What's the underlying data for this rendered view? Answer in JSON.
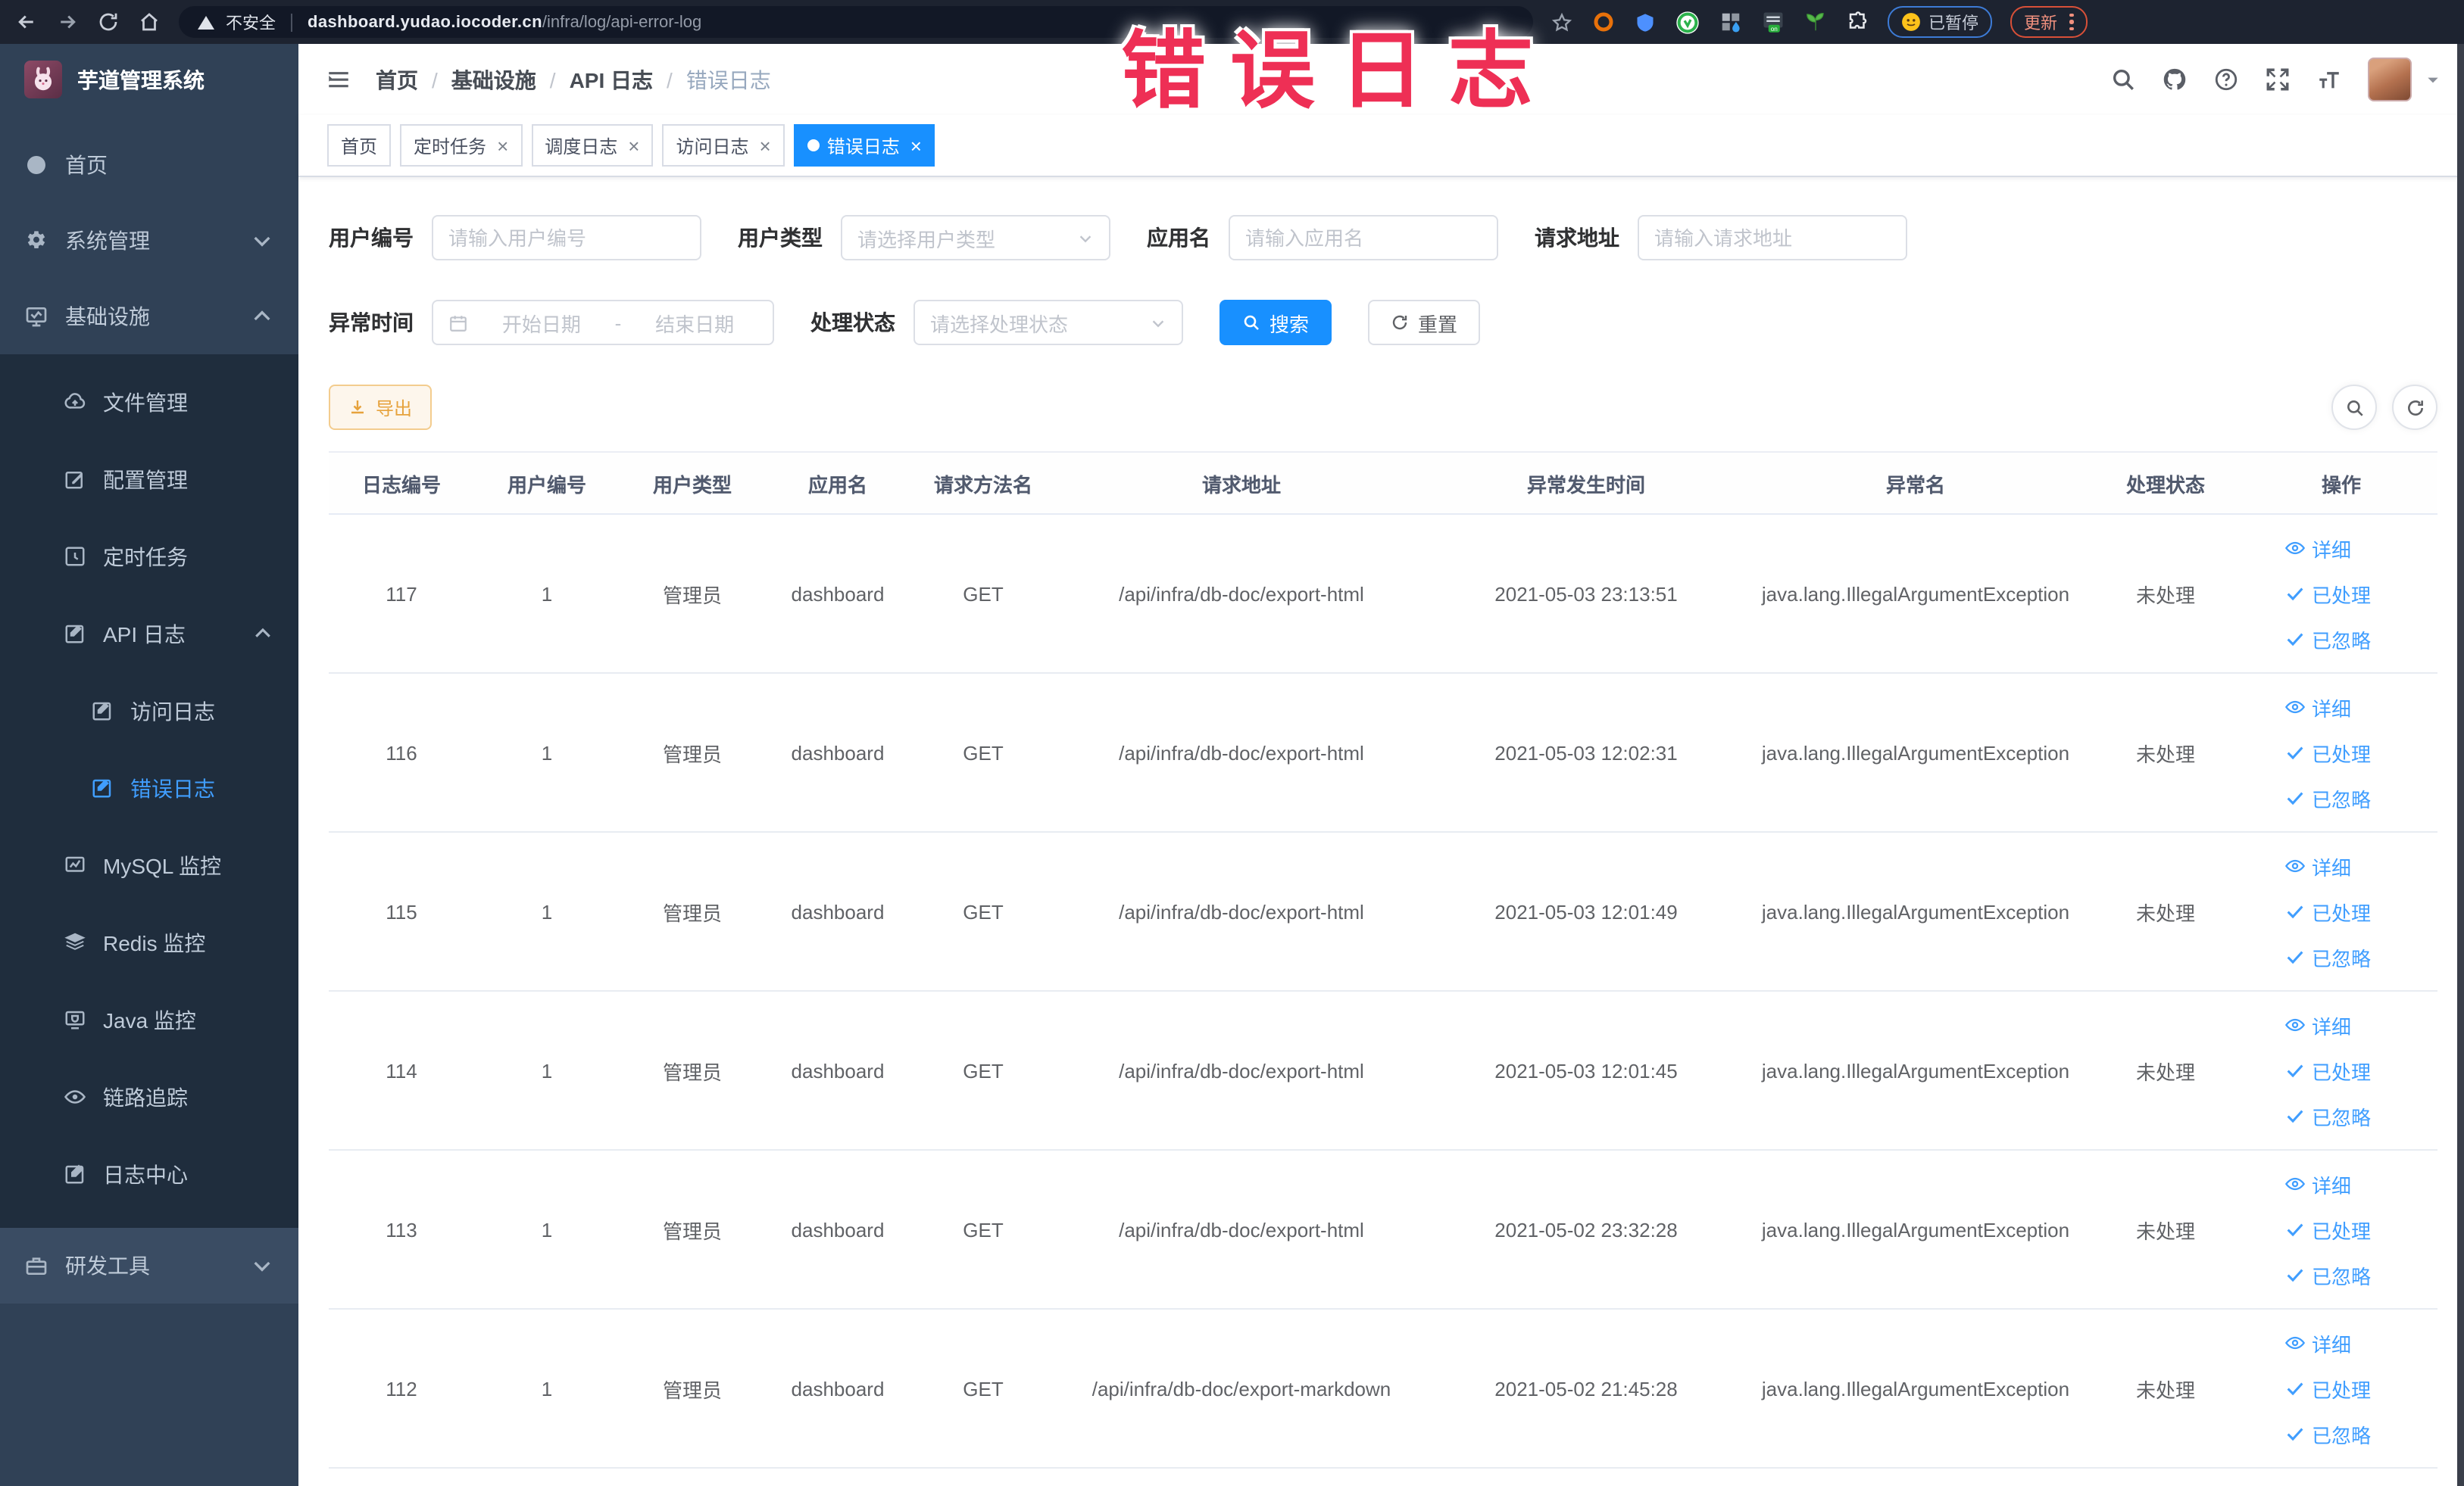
{
  "browser": {
    "security_label": "不安全",
    "url_domain": "dashboard.yudao.iocoder.cn",
    "url_path": "/infra/log/api-error-log",
    "paused_label": "已暂停",
    "update_label": "更新"
  },
  "annotation": {
    "text": "错误日志",
    "color": "#ee2f55"
  },
  "app_header": {
    "breadcrumb": [
      "首页",
      "基础设施",
      "API 日志",
      "错误日志"
    ],
    "separator": "/"
  },
  "icons": {
    "close": "×"
  },
  "tabs": [
    {
      "label": "首页",
      "closable": false,
      "active": false
    },
    {
      "label": "定时任务",
      "closable": true,
      "active": false
    },
    {
      "label": "调度日志",
      "closable": true,
      "active": false
    },
    {
      "label": "访问日志",
      "closable": true,
      "active": false
    },
    {
      "label": "错误日志",
      "closable": true,
      "active": true
    }
  ],
  "sidebar": {
    "title": "芋道管理系统",
    "items": [
      {
        "label": "首页"
      },
      {
        "label": "系统管理"
      },
      {
        "label": "基础设施",
        "children": [
          {
            "label": "文件管理"
          },
          {
            "label": "配置管理"
          },
          {
            "label": "定时任务"
          },
          {
            "label": "API 日志",
            "children": [
              {
                "label": "访问日志"
              },
              {
                "label": "错误日志",
                "active": true
              }
            ]
          },
          {
            "label": "MySQL 监控"
          },
          {
            "label": "Redis 监控"
          },
          {
            "label": "Java 监控"
          },
          {
            "label": "链路追踪"
          },
          {
            "label": "日志中心"
          }
        ]
      },
      {
        "label": "研发工具"
      }
    ]
  },
  "filters": {
    "user_id": {
      "label": "用户编号",
      "placeholder": "请输入用户编号"
    },
    "user_type": {
      "label": "用户类型",
      "placeholder": "请选择用户类型"
    },
    "app_name": {
      "label": "应用名",
      "placeholder": "请输入应用名"
    },
    "request_url": {
      "label": "请求地址",
      "placeholder": "请输入请求地址"
    },
    "exception_time": {
      "label": "异常时间",
      "start_placeholder": "开始日期",
      "separator": "-",
      "end_placeholder": "结束日期"
    },
    "process_status": {
      "label": "处理状态",
      "placeholder": "请选择处理状态"
    },
    "search_label": "搜索",
    "reset_label": "重置"
  },
  "toolbar": {
    "export_label": "导出"
  },
  "table": {
    "columns": [
      "日志编号",
      "用户编号",
      "用户类型",
      "应用名",
      "请求方法名",
      "请求地址",
      "异常发生时间",
      "异常名",
      "处理状态",
      "操作"
    ],
    "row_actions": [
      "详细",
      "已处理",
      "已忽略"
    ],
    "rows": [
      {
        "id": "117",
        "user_id": "1",
        "user_type": "管理员",
        "app": "dashboard",
        "method": "GET",
        "url": "/api/infra/db-doc/export-html",
        "time": "2021-05-03 23:13:51",
        "exception": "java.lang.IllegalArgumentException",
        "status": "未处理"
      },
      {
        "id": "116",
        "user_id": "1",
        "user_type": "管理员",
        "app": "dashboard",
        "method": "GET",
        "url": "/api/infra/db-doc/export-html",
        "time": "2021-05-03 12:02:31",
        "exception": "java.lang.IllegalArgumentException",
        "status": "未处理"
      },
      {
        "id": "115",
        "user_id": "1",
        "user_type": "管理员",
        "app": "dashboard",
        "method": "GET",
        "url": "/api/infra/db-doc/export-html",
        "time": "2021-05-03 12:01:49",
        "exception": "java.lang.IllegalArgumentException",
        "status": "未处理"
      },
      {
        "id": "114",
        "user_id": "1",
        "user_type": "管理员",
        "app": "dashboard",
        "method": "GET",
        "url": "/api/infra/db-doc/export-html",
        "time": "2021-05-03 12:01:45",
        "exception": "java.lang.IllegalArgumentException",
        "status": "未处理"
      },
      {
        "id": "113",
        "user_id": "1",
        "user_type": "管理员",
        "app": "dashboard",
        "method": "GET",
        "url": "/api/infra/db-doc/export-html",
        "time": "2021-05-02 23:32:28",
        "exception": "java.lang.IllegalArgumentException",
        "status": "未处理"
      },
      {
        "id": "112",
        "user_id": "1",
        "user_type": "管理员",
        "app": "dashboard",
        "method": "GET",
        "url": "/api/infra/db-doc/export-markdown",
        "time": "2021-05-02 21:45:28",
        "exception": "java.lang.IllegalArgumentException",
        "status": "未处理"
      }
    ]
  },
  "colors": {
    "primary": "#1890ff",
    "link": "#409eff",
    "sidebar_bg": "#304156",
    "submenu_bg": "#1f2d3d"
  }
}
